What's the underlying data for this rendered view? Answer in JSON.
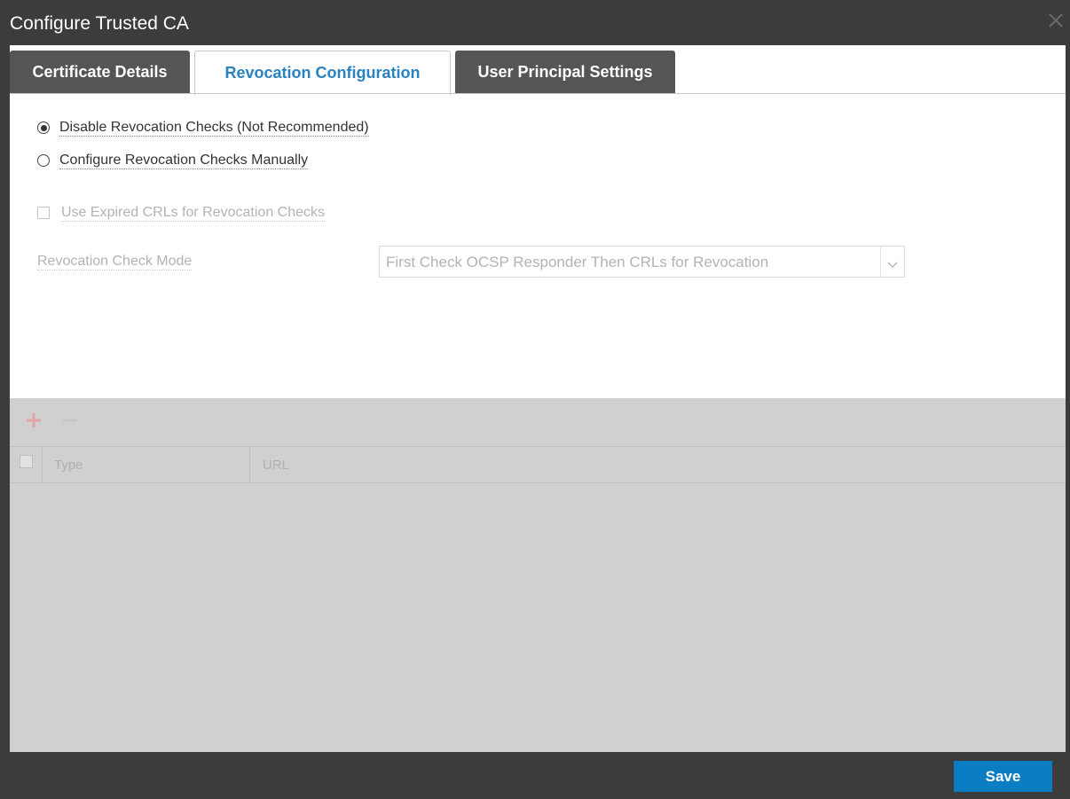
{
  "window": {
    "title": "Configure Trusted CA",
    "close_icon": "close-icon"
  },
  "tabs": [
    {
      "label": "Certificate Details",
      "active": false
    },
    {
      "label": "Revocation Configuration",
      "active": true
    },
    {
      "label": "User Principal Settings",
      "active": false
    }
  ],
  "revocation": {
    "options": [
      {
        "label": "Disable Revocation Checks (Not Recommended)",
        "selected": true
      },
      {
        "label": "Configure Revocation Checks Manually",
        "selected": false
      }
    ],
    "use_expired_crls": {
      "label": "Use Expired CRLs for Revocation Checks",
      "checked": false,
      "enabled": false
    },
    "check_mode": {
      "label": "Revocation Check Mode",
      "selected_value": "First Check OCSP Responder Then CRLs for Revocation",
      "enabled": false
    }
  },
  "table": {
    "toolbar": {
      "add_icon": "plus-icon",
      "remove_icon": "minus-icon"
    },
    "columns": [
      "Type",
      "URL"
    ],
    "rows": []
  },
  "footer": {
    "save_label": "Save"
  },
  "colors": {
    "accent": "#0b7dc3",
    "active_tab_text": "#2a82c0",
    "chrome": "#3c3c3c",
    "disabled_overlay": "#d0d0d0"
  }
}
